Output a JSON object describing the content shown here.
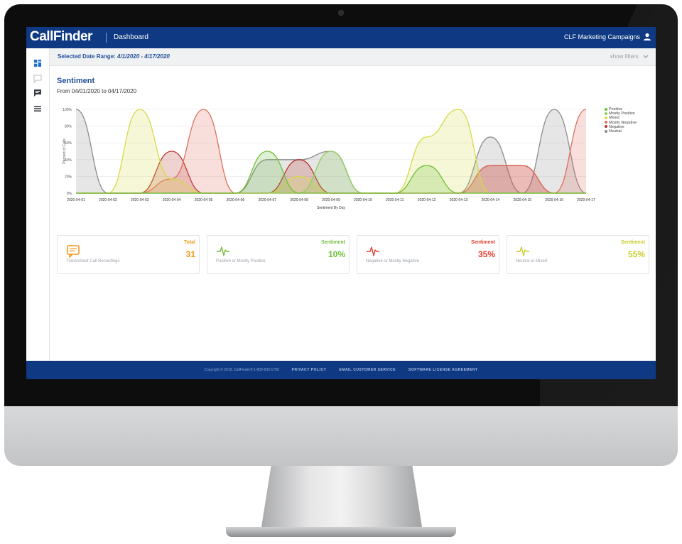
{
  "colors": {
    "brand_navy": "#0f3a83",
    "link_blue": "#1f4f9c",
    "positive": "#6fbf3a",
    "mostly_positive": "#8fcf5a",
    "mixed": "#d7d94a",
    "mostly_negative": "#dd6f5e",
    "negative": "#b8352c",
    "neutral": "#8c8c8c",
    "total_orange": "#f39a1e",
    "sentiment_red": "#e23e2e",
    "sentiment_yellow": "#c9cc2a"
  },
  "app": {
    "logo": "CallFinder",
    "page": "Dashboard",
    "campaign": "CLF Marketing Campaigns",
    "user_icon": "user-icon"
  },
  "sidebar": {
    "items": [
      {
        "icon": "dashboard-grid-icon"
      },
      {
        "icon": "chat-outline-icon"
      },
      {
        "icon": "message-icon"
      },
      {
        "icon": "list-icon"
      }
    ]
  },
  "filterbar": {
    "label": "Selected Date Range: ",
    "value": "4/1/2020 - 4/17/2020",
    "show_filters": "show filters",
    "chevron": "chevron-down-icon"
  },
  "sentiment": {
    "title": "Sentiment",
    "subtitle": "From 04/01/2020 to 04/17/2020"
  },
  "chart_data": {
    "type": "area",
    "title": "",
    "xlabel": "Sentiment By Day",
    "ylabel": "Percent of Calls",
    "ylim": [
      0,
      100
    ],
    "yticks": [
      "0%",
      "20%",
      "40%",
      "60%",
      "80%",
      "100%"
    ],
    "categories": [
      "2020-04-01",
      "2020-04-02",
      "2020-04-03",
      "2020-04-04",
      "2020-04-05",
      "2020-04-06",
      "2020-04-07",
      "2020-04-08",
      "2020-04-09",
      "2020-04-10",
      "2020-04-11",
      "2020-04-12",
      "2020-04-13",
      "2020-04-14",
      "2020-04-15",
      "2020-04-16",
      "2020-04-17"
    ],
    "series": [
      {
        "name": "Positive",
        "color": "#6fbf3a",
        "values": [
          0,
          0,
          0,
          0,
          0,
          0,
          50,
          0,
          0,
          0,
          0,
          33,
          0,
          0,
          0,
          0,
          0
        ]
      },
      {
        "name": "Mostly Positive",
        "color": "#8fcf5a",
        "values": [
          0,
          0,
          0,
          0,
          0,
          0,
          0,
          0,
          50,
          0,
          0,
          0,
          0,
          0,
          0,
          0,
          0
        ]
      },
      {
        "name": "Mixed",
        "color": "#d7d94a",
        "values": [
          0,
          0,
          100,
          17,
          0,
          0,
          0,
          20,
          0,
          0,
          0,
          67,
          100,
          0,
          0,
          0,
          0
        ]
      },
      {
        "name": "Mostly Negative",
        "color": "#dd6f5e",
        "values": [
          0,
          0,
          0,
          17,
          100,
          0,
          0,
          0,
          0,
          0,
          0,
          0,
          0,
          33,
          33,
          0,
          100
        ]
      },
      {
        "name": "Negative",
        "color": "#b8352c",
        "values": [
          0,
          0,
          0,
          50,
          0,
          0,
          0,
          40,
          0,
          0,
          0,
          0,
          0,
          33,
          33,
          0,
          0
        ]
      },
      {
        "name": "Neutral",
        "color": "#8c8c8c",
        "values": [
          100,
          0,
          0,
          0,
          0,
          0,
          40,
          40,
          50,
          0,
          0,
          0,
          0,
          67,
          0,
          100,
          0
        ]
      }
    ],
    "legend": "top-right",
    "grid": true
  },
  "cards": [
    {
      "icon": "chat-bubble-icon",
      "heading": "Total",
      "value": "31",
      "desc": "Transcribed Call Recordings",
      "color": "#f39a1e"
    },
    {
      "icon": "pulse-green-icon",
      "heading": "Sentiment",
      "value": "10%",
      "desc": "Positive or Mostly Positive",
      "color": "#6fbf3a"
    },
    {
      "icon": "pulse-red-icon",
      "heading": "Sentiment",
      "value": "35%",
      "desc": "Negative or Mostly Negative",
      "color": "#e23e2e"
    },
    {
      "icon": "pulse-yellow-icon",
      "heading": "Sentiment",
      "value": "55%",
      "desc": "Neutral or Mixed",
      "color": "#c9cc2a"
    }
  ],
  "footer": {
    "copyright": "Copyright © 2019, CallFinder® 1-800-639-1700",
    "privacy": "PRIVACY POLICY",
    "email": "EMAIL CUSTOMER SERVICE",
    "license": "SOFTWARE LICENSE AGREEMENT"
  }
}
